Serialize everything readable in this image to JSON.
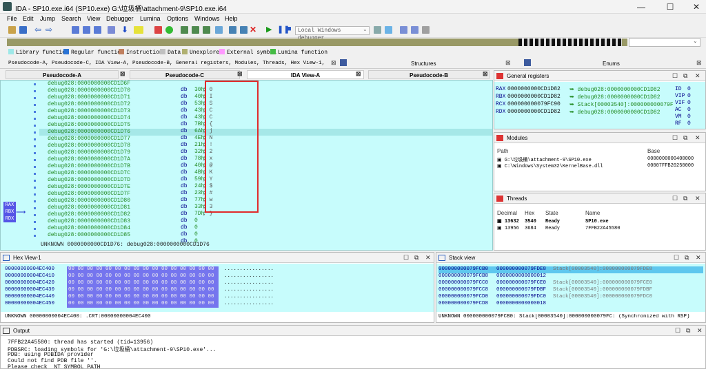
{
  "window": {
    "title": "IDA - SP10.exe.i64 (SP10.exe) G:\\垃圾桶\\attachment-9\\SP10.exe.i64",
    "minimize": "—",
    "maximize": "☐",
    "close": "✕"
  },
  "menu": [
    "File",
    "Edit",
    "Jump",
    "Search",
    "View",
    "Debugger",
    "Lumina",
    "Options",
    "Windows",
    "Help"
  ],
  "toolbar": {
    "debugger": "Local Windows debugger"
  },
  "legend": [
    {
      "label": "Library function",
      "color": "#9ee8e8"
    },
    {
      "label": "Regular function",
      "color": "#2a74d6"
    },
    {
      "label": "Instruction",
      "color": "#c08060"
    },
    {
      "label": "Data",
      "color": "#c0c0c0"
    },
    {
      "label": "Unexplored",
      "color": "#b0b070"
    },
    {
      "label": "External symbol",
      "color": "#ff99ff"
    },
    {
      "label": "Lumina function",
      "color": "#44bb44"
    }
  ],
  "doctabs": {
    "main": "Pseudocode-A, Pseudocode-C, IDA View-A, Pseudocode-B, General registers, Modules, Threads, Hex View-1, Stack view",
    "structures": "Structures",
    "enums": "Enums"
  },
  "viewtabs": [
    "Pseudocode-A",
    "Pseudocode-C",
    "IDA View-A",
    "Pseudocode-B"
  ],
  "disasm": {
    "lines": [
      {
        "addr": "debug028:0000000000CD1D6F",
        "op": "db",
        "val": "30h",
        "cm": "; 0"
      },
      {
        "addr": "debug028:0000000000CD1D70",
        "op": "db",
        "val": "40h",
        "cm": "; I"
      },
      {
        "addr": "debug028:0000000000CD1D71",
        "op": "db",
        "val": "53h",
        "cm": "; S"
      },
      {
        "addr": "debug028:0000000000CD1D72",
        "op": "db",
        "val": "43h",
        "cm": "; C"
      },
      {
        "addr": "debug028:0000000000CD1D73",
        "op": "db",
        "val": "43h",
        "cm": "; C"
      },
      {
        "addr": "debug028:0000000000CD1D74",
        "op": "db",
        "val": "7Bh",
        "cm": "; {"
      },
      {
        "addr": "debug028:0000000000CD1D75",
        "op": "db",
        "val": "6Ah",
        "cm": "; j"
      },
      {
        "addr": "debug028:0000000000CD1D76",
        "op": "db",
        "val": "4Eh",
        "cm": "; N"
      },
      {
        "addr": "debug028:0000000000CD1D77",
        "op": "db",
        "val": "21h",
        "cm": "; !"
      },
      {
        "addr": "debug028:0000000000CD1D78",
        "op": "db",
        "val": "32h",
        "cm": "; 2"
      },
      {
        "addr": "debug028:0000000000CD1D79",
        "op": "db",
        "val": "78h",
        "cm": "; x"
      },
      {
        "addr": "debug028:0000000000CD1D7A",
        "op": "db",
        "val": "40h",
        "cm": "; @"
      },
      {
        "addr": "debug028:0000000000CD1D7B",
        "op": "db",
        "val": "4Bh",
        "cm": "; K"
      },
      {
        "addr": "debug028:0000000000CD1D7C",
        "op": "db",
        "val": "59h",
        "cm": "; Y"
      },
      {
        "addr": "debug028:0000000000CD1D7D",
        "op": "db",
        "val": "24h",
        "cm": "; $"
      },
      {
        "addr": "debug028:0000000000CD1D7E",
        "op": "db",
        "val": "23h",
        "cm": "; #"
      },
      {
        "addr": "debug028:0000000000CD1D7F",
        "op": "db",
        "val": "77h",
        "cm": "; w"
      },
      {
        "addr": "debug028:0000000000CD1D80",
        "op": "db",
        "val": "33h",
        "cm": "; 3"
      },
      {
        "addr": "debug028:0000000000CD1D81",
        "op": "db",
        "val": "7Dh",
        "cm": "; }"
      },
      {
        "addr": "debug028:0000000000CD1D82",
        "op": "db",
        "val": "0",
        "cm": ""
      },
      {
        "addr": "debug028:0000000000CD1D83",
        "op": "db",
        "val": "0",
        "cm": ""
      },
      {
        "addr": "debug028:0000000000CD1D84",
        "op": "db",
        "val": "0",
        "cm": ""
      },
      {
        "addr": "debug028:0000000000CD1D85",
        "op": "db",
        "val": "0",
        "cm": ""
      }
    ],
    "status": "UNKNOWN 0000000000CD1D76: debug028:0000000000CD1D76",
    "reg_labels": [
      "RAX",
      "RBX",
      "RDX"
    ]
  },
  "registers": {
    "title": "General registers",
    "rows": [
      {
        "name": "RAX",
        "value": "0000000000CD1D82",
        "comment": "debug028:0000000000CD1D82"
      },
      {
        "name": "RBX",
        "value": "0000000000CD1D82",
        "comment": "debug028:0000000000CD1D82"
      },
      {
        "name": "RCX",
        "value": "000000000079FC90",
        "comment": "Stack[00003540]:000000000079FC"
      },
      {
        "name": "RDX",
        "value": "0000000000CD1D82",
        "comment": "debug028:0000000000CD1D82"
      }
    ],
    "flags": [
      {
        "n": "ID",
        "v": "0"
      },
      {
        "n": "VIP",
        "v": "0"
      },
      {
        "n": "VIF",
        "v": "0"
      },
      {
        "n": "AC",
        "v": "0"
      },
      {
        "n": "VM",
        "v": "0"
      },
      {
        "n": "RF",
        "v": "0"
      }
    ]
  },
  "modules": {
    "title": "Modules",
    "col_path": "Path",
    "col_base": "Base",
    "rows": [
      {
        "path": "G:\\垃圾桶\\attachment-9\\SP10.exe",
        "base": "0000000000400000"
      },
      {
        "path": "C:\\Windows\\System32\\KernelBase.dll",
        "base": "00007FFB20250000"
      }
    ]
  },
  "threads": {
    "title": "Threads",
    "cols": [
      "Decimal",
      "Hex",
      "State",
      "Name"
    ],
    "rows": [
      {
        "dec": "13632",
        "hex": "3540",
        "state": "Ready",
        "name": "SP10.exe"
      },
      {
        "dec": "13956",
        "hex": "3684",
        "state": "Ready",
        "name": "7FFB22A45580"
      }
    ]
  },
  "hexview": {
    "title": "Hex View-1",
    "rows": [
      {
        "addr": "00000000004EC400",
        "bytes": "00 00 00 00 00 00 00 00  00 00 00 00 00 00 00 00",
        "ascii": "................"
      },
      {
        "addr": "00000000004EC410",
        "bytes": "00 00 00 00 00 00 00 00  00 00 00 00 00 00 00 00",
        "ascii": "................"
      },
      {
        "addr": "00000000004EC420",
        "bytes": "00 00 00 00 00 00 00 00  00 00 00 00 00 00 00 00",
        "ascii": "................"
      },
      {
        "addr": "00000000004EC430",
        "bytes": "00 00 00 00 00 00 00 00  00 00 00 00 00 00 00 00",
        "ascii": "................"
      },
      {
        "addr": "00000000004EC440",
        "bytes": "00 00 00 00 00 00 00 00  00 00 00 00 00 00 00 00",
        "ascii": "................"
      },
      {
        "addr": "00000000004EC450",
        "bytes": "00 00 00 00 00 00 00 00  00 00 00 00 00 00 00 00",
        "ascii": "................"
      }
    ],
    "status": "UNKNOWN 00000000004EC400: .CRT:00000000004EC400"
  },
  "stackview": {
    "title": "Stack view",
    "rows": [
      {
        "addr": "000000000079FCB0",
        "val": "000000000079FDE8",
        "cm": "Stack[00003540]:000000000079FDE8"
      },
      {
        "addr": "000000000079FCB8",
        "val": "0000000000000012",
        "cm": ""
      },
      {
        "addr": "000000000079FCC0",
        "val": "000000000079FCE0",
        "cm": "Stack[00003540]:000000000079FCE0"
      },
      {
        "addr": "000000000079FCC8",
        "val": "000000000079FDBF",
        "cm": "Stack[00003540]:000000000079FDBF"
      },
      {
        "addr": "000000000079FCD0",
        "val": "000000000079FDC0",
        "cm": "Stack[00003540]:000000000079FDC0"
      },
      {
        "addr": "000000000079FCD8",
        "val": "0000000000000018",
        "cm": ""
      }
    ],
    "status": "UNKNOWN 000000000079FCB0: Stack[00003540]:000000000079FC: (Synchronized with RSP)"
  },
  "output": {
    "title": "Output",
    "lines": [
      "7FFB22A45580: thread has started (tid=13956)",
      "PDBSRC: loading symbols for 'G:\\垃圾桶\\attachment-9\\SP10.exe'...",
      "PDB: using PDBIDA provider",
      "Could not find PDB file ''.",
      "Please check _NT_SYMBOL_PATH"
    ]
  }
}
